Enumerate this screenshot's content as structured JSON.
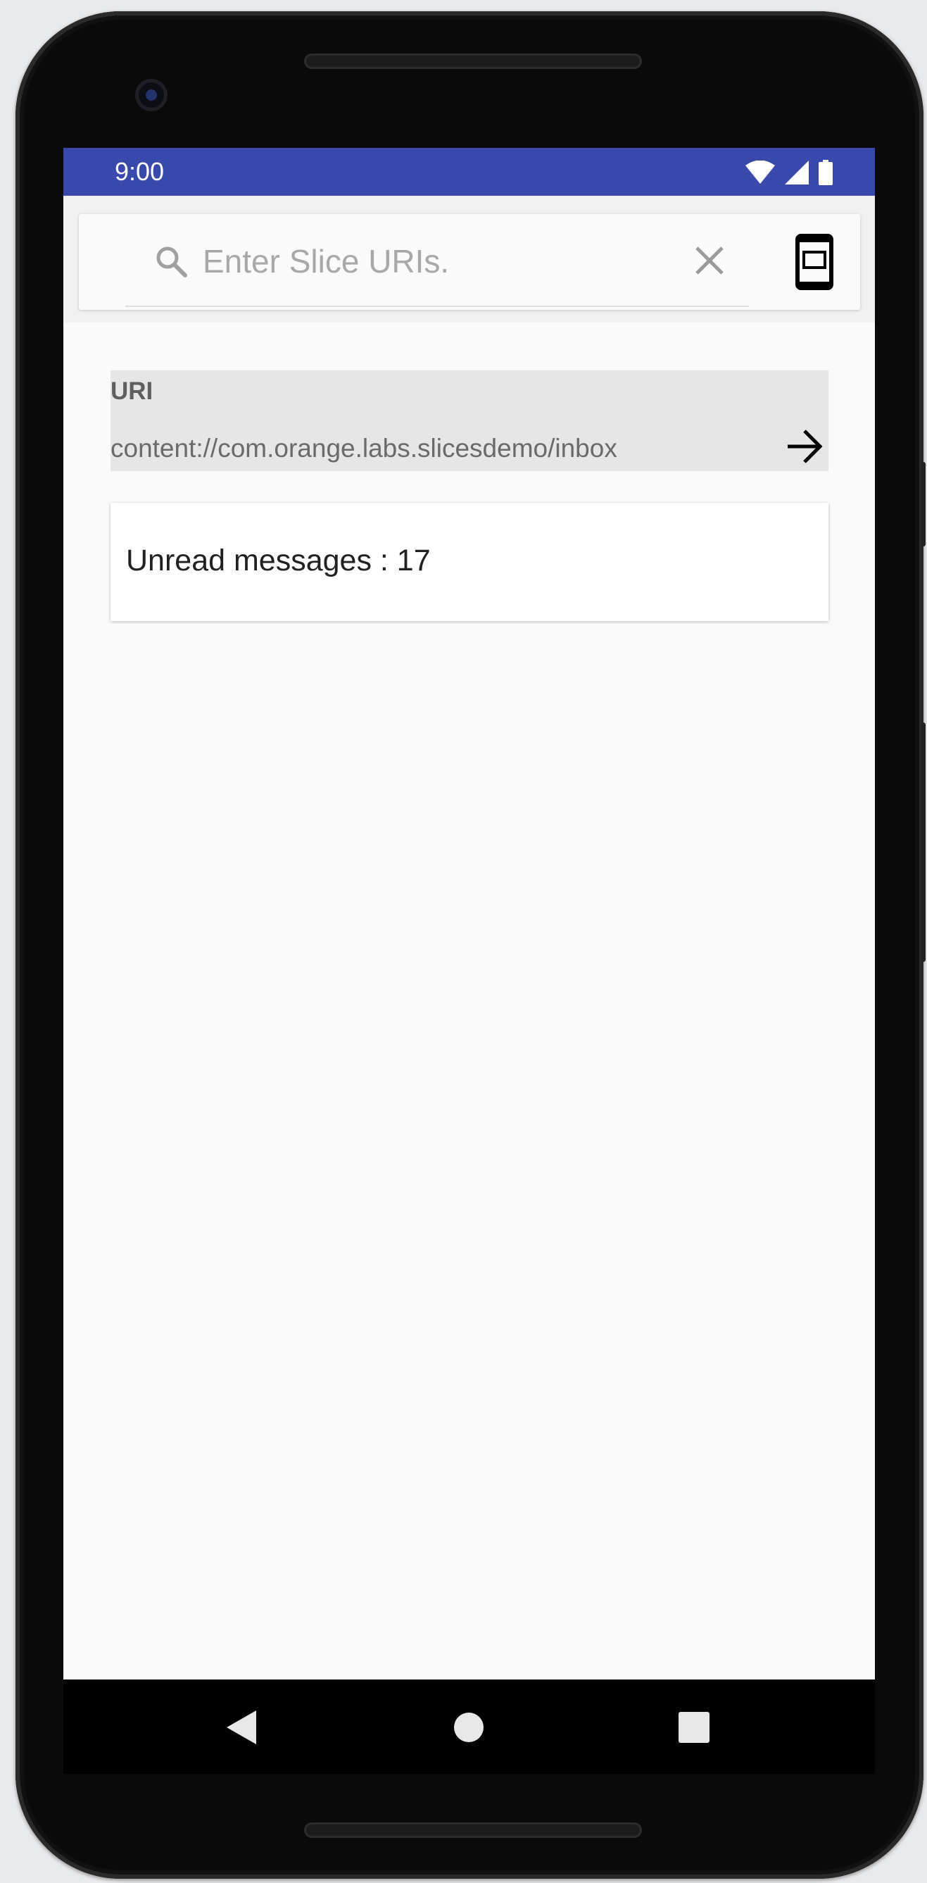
{
  "status_bar": {
    "time": "9:00",
    "icons": [
      "wifi-icon",
      "cellular-signal-icon",
      "battery-icon"
    ],
    "color": "#3949ab"
  },
  "search": {
    "placeholder": "Enter Slice URIs.",
    "value": "",
    "icons": [
      "search-icon",
      "clear-icon",
      "display-mode-icon"
    ]
  },
  "uri_panel": {
    "label": "URI",
    "value": "content://com.orange.labs.slicesdemo/inbox",
    "action_icon": "arrow-forward-icon"
  },
  "slice": {
    "text": "Unread messages : 17"
  },
  "nav_bar": {
    "buttons": [
      "back-icon",
      "home-icon",
      "recents-icon"
    ]
  }
}
